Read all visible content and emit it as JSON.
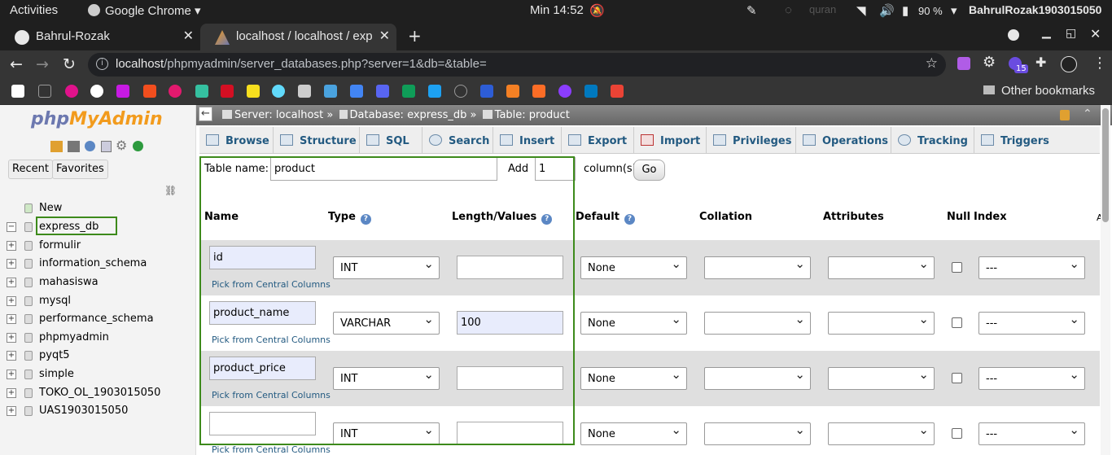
{
  "os": {
    "activities": "Activities",
    "app": "Google Chrome",
    "clock": "Min 14:52",
    "battery": "90 %",
    "user": "BahrulRozak1903015050",
    "quran": "quran"
  },
  "browser": {
    "tabs": [
      {
        "title": "Bahrul-Rozak"
      },
      {
        "title": "localhost / localhost / exp"
      }
    ],
    "url_host": "localhost",
    "url_path": "/phpmyadmin/server_databases.php?server=1&db=&table=",
    "ext_badge": "15",
    "other_bookmarks": "Other bookmarks"
  },
  "sidebar": {
    "logo_php": "php",
    "logo_myadmin": "MyAdmin",
    "recent": "Recent",
    "favorites": "Favorites",
    "tree": [
      {
        "label": "New"
      },
      {
        "label": "express_db"
      },
      {
        "label": "formulir"
      },
      {
        "label": "information_schema"
      },
      {
        "label": "mahasiswa"
      },
      {
        "label": "mysql"
      },
      {
        "label": "performance_schema"
      },
      {
        "label": "phpmyadmin"
      },
      {
        "label": "pyqt5"
      },
      {
        "label": "simple"
      },
      {
        "label": "TOKO_OL_1903015050"
      },
      {
        "label": "UAS1903015050"
      }
    ]
  },
  "breadcrumb": {
    "server": "Server: localhost",
    "db": "Database: express_db",
    "table": "Table: product",
    "sep": "»"
  },
  "tabs": [
    {
      "label": "Browse"
    },
    {
      "label": "Structure"
    },
    {
      "label": "SQL"
    },
    {
      "label": "Search"
    },
    {
      "label": "Insert"
    },
    {
      "label": "Export"
    },
    {
      "label": "Import"
    },
    {
      "label": "Privileges"
    },
    {
      "label": "Operations"
    },
    {
      "label": "Tracking"
    },
    {
      "label": "Triggers"
    }
  ],
  "form": {
    "table_name_label": "Table name:",
    "table_name": "product",
    "add_label": "Add",
    "add_value": "1",
    "columns_label": "column(s)",
    "go": "Go",
    "headers": {
      "name": "Name",
      "type": "Type",
      "length": "Length/Values",
      "default": "Default",
      "collation": "Collation",
      "attributes": "Attributes",
      "null": "Null",
      "index": "Index",
      "ai": "A"
    },
    "pick": "Pick from Central Columns",
    "rows": [
      {
        "name": "id",
        "type": "INT",
        "length": "",
        "default": "None",
        "index": "---"
      },
      {
        "name": "product_name",
        "type": "VARCHAR",
        "length": "100",
        "default": "None",
        "index": "---"
      },
      {
        "name": "product_price",
        "type": "INT",
        "length": "",
        "default": "None",
        "index": "---"
      },
      {
        "name": "",
        "type": "INT",
        "length": "",
        "default": "None",
        "index": "---"
      }
    ]
  }
}
